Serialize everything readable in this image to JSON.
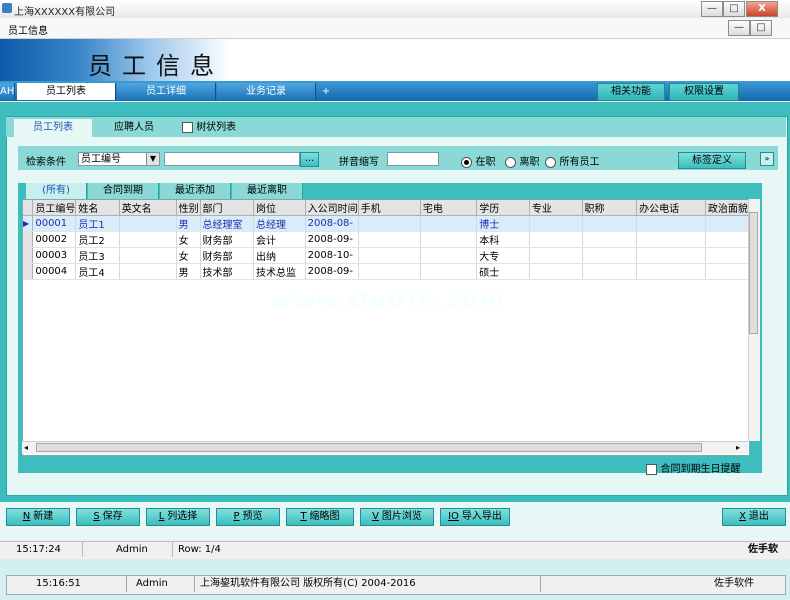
{
  "outer_window": {
    "title": "上海XXXXXX有限公司",
    "buttons": [
      "—",
      "□",
      "X"
    ]
  },
  "inner_window": {
    "title": "员工信息",
    "buttons": [
      "—",
      "□"
    ]
  },
  "banner": {
    "title": "员工信息"
  },
  "main_tabs": [
    {
      "label": "AH"
    },
    {
      "label": "员工列表"
    },
    {
      "label": "员工详细"
    },
    {
      "label": "业务记录"
    },
    {
      "label": "+"
    }
  ],
  "right_buttons": [
    {
      "label": "相关功能"
    },
    {
      "label": "权限设置"
    }
  ],
  "sub_tabs": {
    "list": "员工列表",
    "applicants": "应聘人员",
    "tree_checkbox": "树状列表"
  },
  "search": {
    "label": "检索条件",
    "field_select": "员工编号",
    "query_value": "",
    "dots_button": "...",
    "pinyin_label": "拼音缩写",
    "pinyin_value": "",
    "status_options": [
      {
        "label": "在职",
        "selected": true
      },
      {
        "label": "离职",
        "selected": false
      },
      {
        "label": "所有员工",
        "selected": false
      }
    ],
    "tag_button": "标签定义"
  },
  "grid_tabs": [
    {
      "label": "(所有)"
    },
    {
      "label": "合同到期"
    },
    {
      "label": "最近添加"
    },
    {
      "label": "最近离职"
    }
  ],
  "grid": {
    "columns": [
      "员工编号",
      "姓名",
      "英文名",
      "性别",
      "部门",
      "岗位",
      "入公司时间",
      "手机",
      "宅电",
      "学历",
      "专业",
      "职称",
      "办公电话",
      "政治面貌"
    ],
    "rows": [
      [
        "00001",
        "员工1",
        "",
        "男",
        "总经理室",
        "总经理",
        "2008-08-",
        "",
        "",
        "博士",
        "",
        "",
        "",
        ""
      ],
      [
        "00002",
        "员工2",
        "",
        "女",
        "财务部",
        "会计",
        "2008-09-",
        "",
        "",
        "本科",
        "",
        "",
        "",
        ""
      ],
      [
        "00003",
        "员工3",
        "",
        "女",
        "财务部",
        "出纳",
        "2008-10-",
        "",
        "",
        "大专",
        "",
        "",
        "",
        ""
      ],
      [
        "00004",
        "员工4",
        "",
        "男",
        "技术部",
        "技术总监",
        "2008-09-",
        "",
        "",
        "硕士",
        "",
        "",
        "",
        ""
      ]
    ],
    "selected_row": 0
  },
  "reminder": {
    "label": "合同到期生日提醒"
  },
  "toolbar": [
    {
      "key": "N",
      "label": "新建"
    },
    {
      "key": "S",
      "label": "保存"
    },
    {
      "key": "L",
      "label": "列选择"
    },
    {
      "key": "P",
      "label": "预览"
    },
    {
      "key": "T",
      "label": "缩略图"
    },
    {
      "key": "V",
      "label": "图片浏览"
    },
    {
      "key": "IO",
      "label": "导入导出"
    }
  ],
  "exit_button": {
    "key": "X",
    "label": "退出"
  },
  "status_inner": {
    "time": "15:17:24",
    "user": "Admin",
    "row": "Row: 1/4",
    "brand": "佐手软"
  },
  "status_outer": {
    "time": "15:16:51",
    "user": "Admin",
    "copyright": "上海鋆玑软件有限公司 版权所有(C) 2004-2016",
    "brand": "佐手软件"
  },
  "watermark": "www.DuoTe.com"
}
